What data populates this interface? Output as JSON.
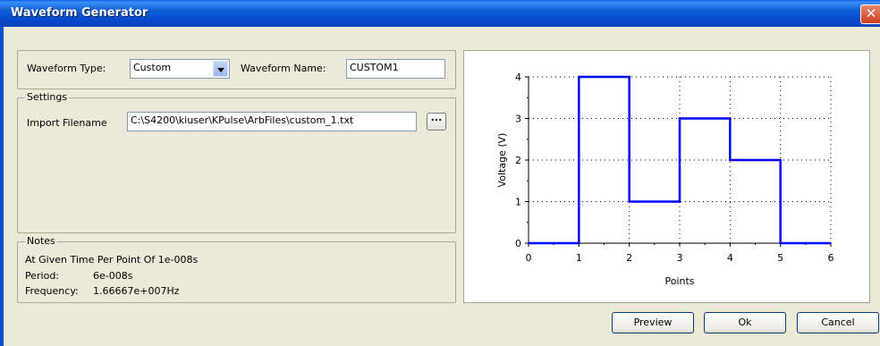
{
  "window": {
    "title": "Waveform Generator",
    "close_label": "✕"
  },
  "waveform": {
    "type_label": "Waveform Type:",
    "type_value": "Custom",
    "name_label": "Waveform Name:",
    "name_value": "CUSTOM1"
  },
  "settings": {
    "group_label": "Settings",
    "import_label": "Import Filename",
    "import_value": "C:\\S4200\\kiuser\\KPulse\\ArbFiles\\custom_1.txt",
    "browse_label": "..."
  },
  "notes": {
    "group_label": "Notes",
    "line1": "At Given Time Per Point Of 1e-008s",
    "period_label": "Period:",
    "period_value": "6e-008s",
    "frequency_label": "Frequency:",
    "frequency_value": "1.66667e+007Hz"
  },
  "buttons": {
    "preview": "Preview",
    "ok": "Ok",
    "cancel": "Cancel"
  },
  "colors": {
    "series": "#0000ff",
    "title_bar": "#0a5fe8"
  },
  "chart_data": {
    "type": "line",
    "step": true,
    "x": [
      0,
      1,
      1,
      2,
      2,
      3,
      3,
      4,
      4,
      5,
      5,
      6
    ],
    "y": [
      0,
      0,
      4,
      4,
      1,
      1,
      3,
      3,
      2,
      2,
      0,
      0
    ],
    "xlabel": "Points",
    "ylabel": "Voltage (V)",
    "xlim": [
      0,
      6
    ],
    "ylim": [
      0,
      4
    ],
    "xticks": [
      "0",
      "1",
      "2",
      "3",
      "4",
      "5",
      "6"
    ],
    "yticks": [
      "0",
      "1",
      "2",
      "3",
      "4"
    ],
    "grid": "dotted"
  }
}
